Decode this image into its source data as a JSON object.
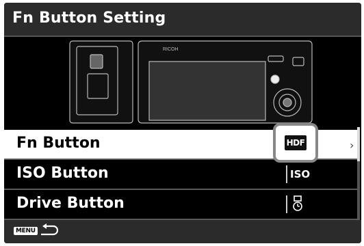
{
  "title": "Fn Button Setting",
  "illustration": {
    "brand_text": "RICOH"
  },
  "menu": {
    "items": [
      {
        "label": "Fn Button",
        "value": "HDF"
      },
      {
        "label": "ISO Button",
        "value": "ISO"
      },
      {
        "label": "Drive Button",
        "value": "drive-self-timer-icon"
      }
    ],
    "selected_index": 0
  },
  "footer": {
    "menu_key": "MENU"
  },
  "colors": {
    "background": "#000000",
    "title_bar": "#2b2b2b",
    "selected_row": "#ffffff",
    "highlight_border": "#888888"
  }
}
